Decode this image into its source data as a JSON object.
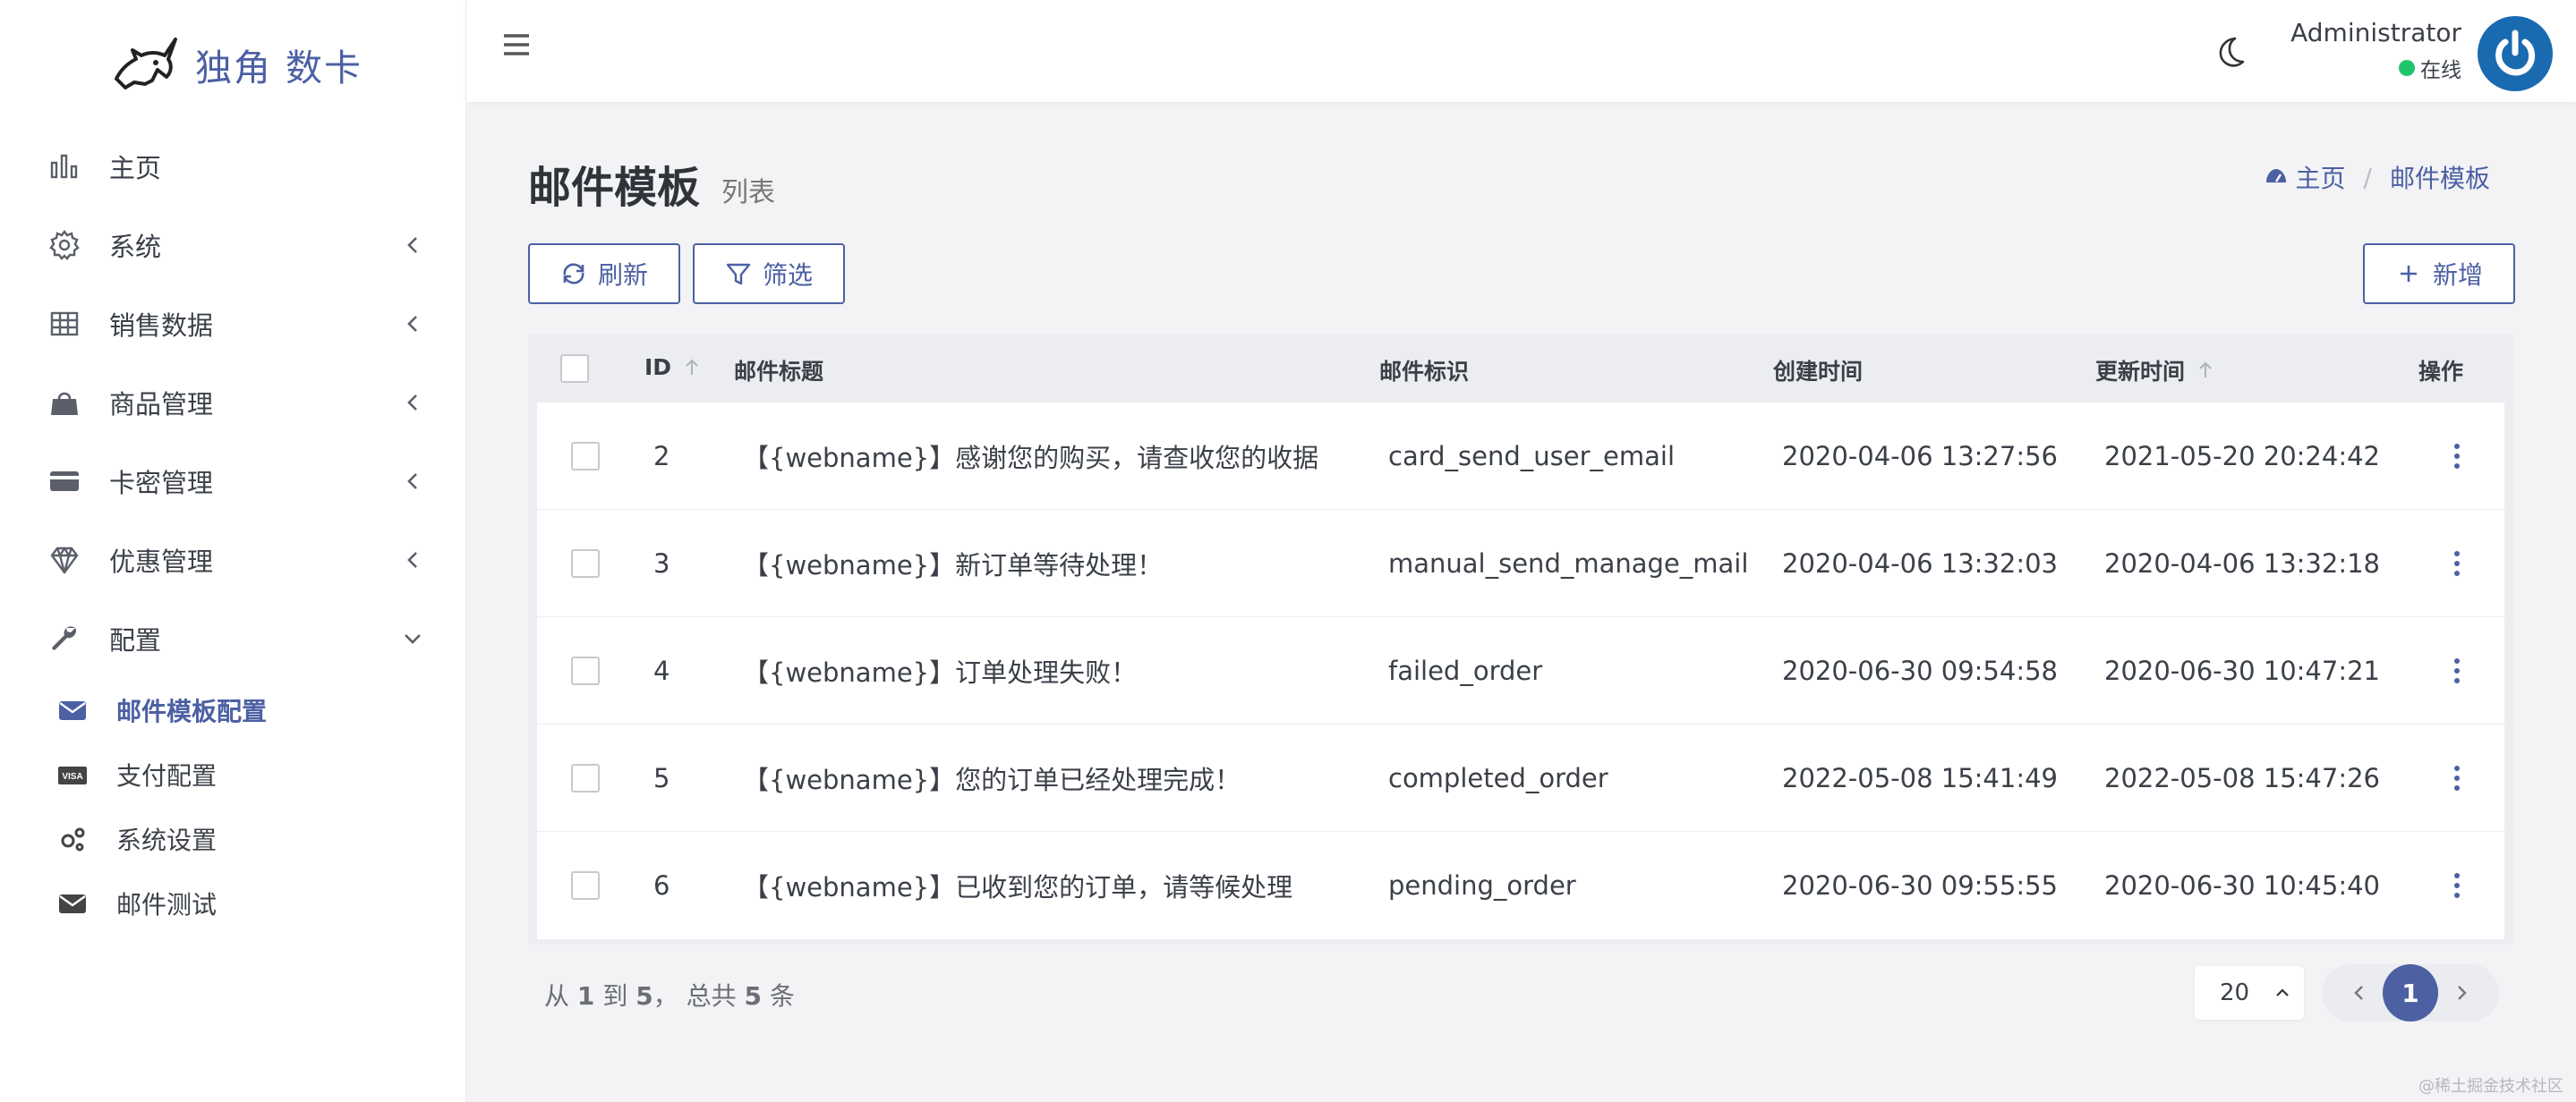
{
  "brand": {
    "name": "独角 数卡"
  },
  "sidebar": {
    "items": [
      {
        "label": "主页",
        "icon": "bar-chart-icon"
      },
      {
        "label": "系统",
        "icon": "gear-icon"
      },
      {
        "label": "销售数据",
        "icon": "table-icon"
      },
      {
        "label": "商品管理",
        "icon": "shopping-bag-icon"
      },
      {
        "label": "卡密管理",
        "icon": "credit-card-icon"
      },
      {
        "label": "优惠管理",
        "icon": "diamond-icon"
      },
      {
        "label": "配置",
        "icon": "wrench-icon"
      }
    ],
    "submenu": [
      {
        "label": "邮件模板配置",
        "icon": "envelope-icon",
        "active": true
      },
      {
        "label": "支付配置",
        "icon": "visa-icon"
      },
      {
        "label": "系统设置",
        "icon": "gears-icon"
      },
      {
        "label": "邮件测试",
        "icon": "envelope-icon"
      }
    ]
  },
  "topbar": {
    "user_name": "Administrator",
    "status": "在线"
  },
  "header": {
    "title": "邮件模板",
    "subtitle": "列表",
    "breadcrumb_home": "主页",
    "breadcrumb_current": "邮件模板",
    "breadcrumb_sep": "/"
  },
  "toolbar": {
    "refresh_label": "刷新",
    "filter_label": "筛选",
    "add_label": "新增"
  },
  "table": {
    "columns": [
      "ID",
      "邮件标题",
      "邮件标识",
      "创建时间",
      "更新时间",
      "操作"
    ],
    "rows": [
      {
        "id": "2",
        "title": "【{webname}】感谢您的购买，请查收您的收据",
        "token": "card_send_user_email",
        "created": "2020-04-06 13:27:56",
        "updated": "2021-05-20 20:24:42"
      },
      {
        "id": "3",
        "title": "【{webname}】新订单等待处理！",
        "token": "manual_send_manage_mail",
        "created": "2020-04-06 13:32:03",
        "updated": "2020-04-06 13:32:18"
      },
      {
        "id": "4",
        "title": "【{webname}】订单处理失败！",
        "token": "failed_order",
        "created": "2020-06-30 09:54:58",
        "updated": "2020-06-30 10:47:21"
      },
      {
        "id": "5",
        "title": "【{webname}】您的订单已经处理完成！",
        "token": "completed_order",
        "created": "2022-05-08 15:41:49",
        "updated": "2022-05-08 15:47:26"
      },
      {
        "id": "6",
        "title": "【{webname}】已收到您的订单，请等候处理",
        "token": "pending_order",
        "created": "2020-06-30 09:55:55",
        "updated": "2020-06-30 10:45:40"
      }
    ]
  },
  "footer": {
    "count_from_word": "从",
    "count_from": "1",
    "count_to_word": "到",
    "count_to": "5",
    "count_total_word": "，  总共",
    "count_total": "5",
    "count_unit": "条",
    "per_page": "20",
    "current_page": "1"
  },
  "watermark": "@稀土掘金技术社区",
  "colors": {
    "accent": "#4c60a3",
    "online": "#20c56b",
    "avatar": "#1a6ab0"
  }
}
